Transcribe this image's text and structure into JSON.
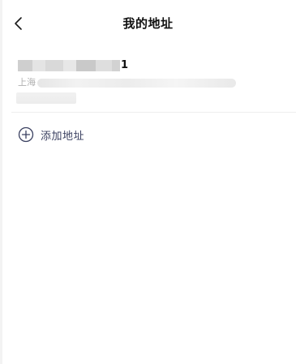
{
  "header": {
    "title": "我的地址",
    "back_icon": "chevron-left-icon"
  },
  "address": {
    "name_phone_visible_tail": "1",
    "city": "上海"
  },
  "actions": {
    "add_label": "添加地址",
    "add_icon": "plus-circle-icon"
  },
  "colors": {
    "title": "#111111",
    "add_text": "#3b4161",
    "divider": "#eeeeee"
  }
}
